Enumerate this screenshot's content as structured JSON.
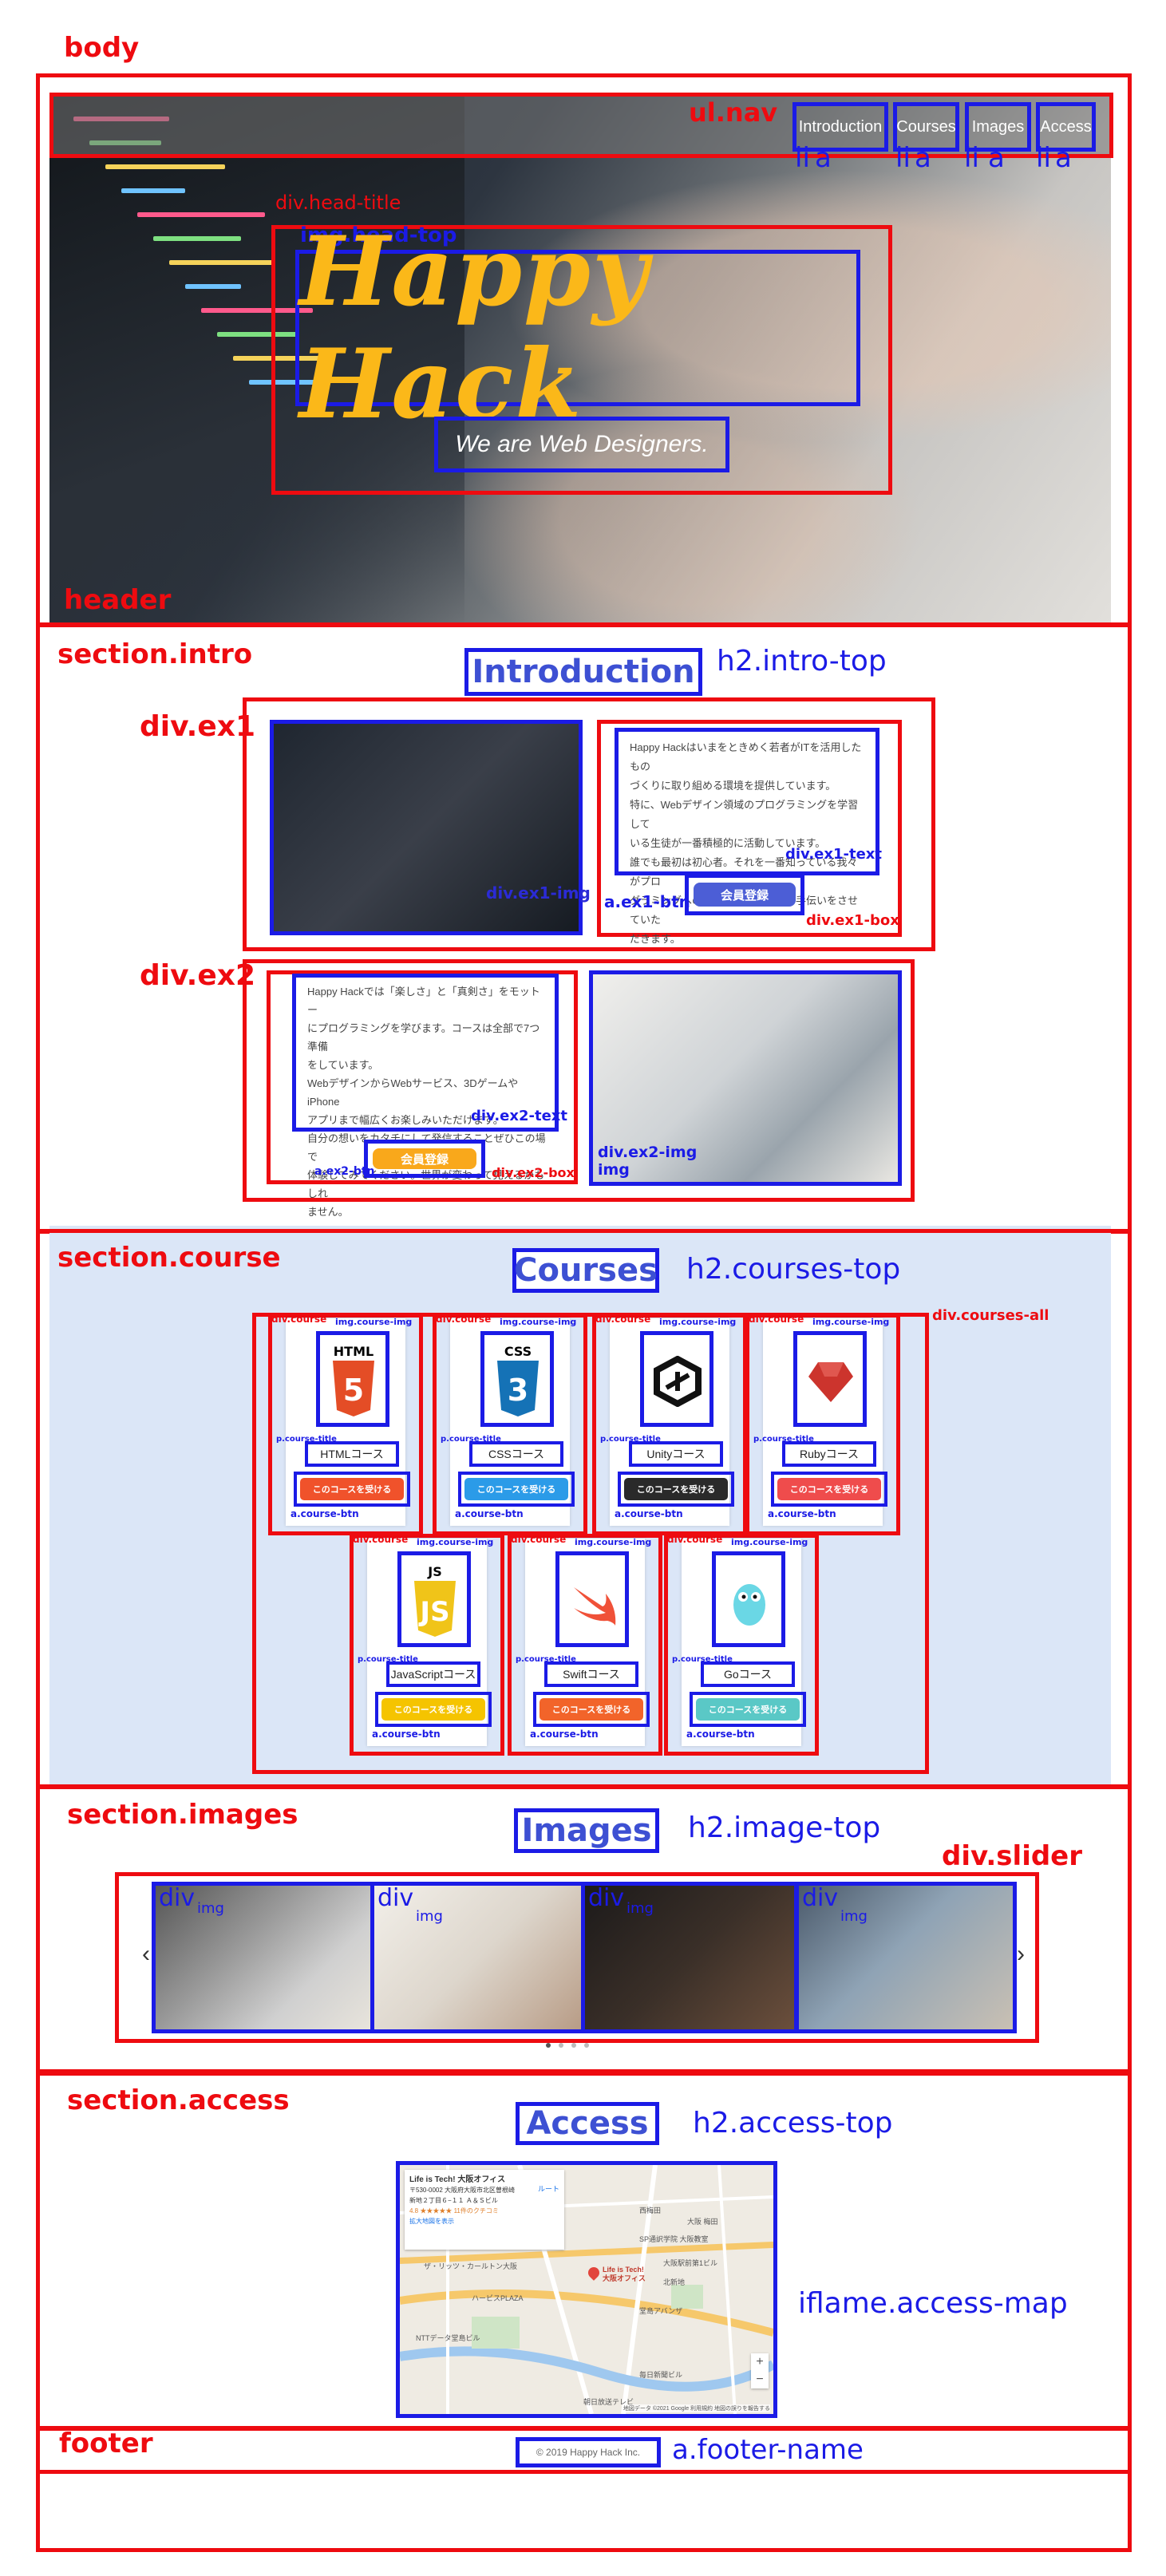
{
  "labels": {
    "body": "body",
    "header": "header",
    "ul_nav": "ul.nav",
    "head_title": "div.head-title",
    "img_head_top": "img.head-top",
    "section_intro": "section.intro",
    "h2_intro_top": "h2.intro-top",
    "div_ex1": "div.ex1",
    "div_ex1_img": "div.ex1-img",
    "div_ex1_text": "div.ex1-text",
    "a_ex1_btn": "a.ex1-btn",
    "div_ex1_box": "div.ex1-box",
    "div_ex2": "div.ex2",
    "div_ex2_text": "div.ex2-text",
    "a_ex2_btn": "a.ex2-btn",
    "div_ex2_box": "div.ex2-box",
    "div_ex2_img": "div.ex2-img",
    "img": "img",
    "section_course": "section.course",
    "h2_courses_top": "h2.courses-top",
    "div_courses_all": "div.courses-all",
    "div_course": "div.course",
    "img_course_img": "img.course-img",
    "p_course_title": "p.course-title",
    "a_course_btn": "a.course-btn",
    "section_images": "section.images",
    "h2_image_top": "h2.image-top",
    "div_slider": "div.slider",
    "div": "div",
    "section_access": "section.access",
    "h2_access_top": "h2.access-top",
    "iflame_access_map": "iflame.access-map",
    "footer": "footer",
    "a_footer_name": "a.footer-name",
    "li": "li",
    "a": "a"
  },
  "nav": {
    "items": [
      "Introduction",
      "Courses",
      "Images",
      "Access"
    ]
  },
  "header": {
    "title": "Happy Hack",
    "subtitle": "We are Web Designers."
  },
  "intro": {
    "heading": "Introduction",
    "ex1_text": [
      "Happy Hackはいまをときめく若者がITを活用したもの",
      "づくりに取り組める環境を提供しています。",
      "特に、Webデザイン領域のプログラミングを学習して",
      "いる生徒が一番積極的に活動しています。",
      "誰でも最初は初心者。それを一番知っている我々がプロ",
      "グラミングへの第一歩を踏み出すお手伝いをさせていた",
      "だきます。"
    ],
    "ex1_btn": "会員登録",
    "ex2_text": [
      "Happy Hackでは「楽しさ」と「真剣さ」をモットー",
      "にプログラミングを学びます。コースは全部で7つ準備",
      "をしています。",
      "WebデザインからWebサービス、3DゲームやiPhone",
      "アプリまで幅広くお楽しみいただけます。",
      "自分の想いをカタチにして発信することぜひこの場で",
      "体験してみてください。世界が変わって見えるかもしれ",
      "ません。"
    ],
    "ex2_btn": "会員登録"
  },
  "courses": {
    "heading": "Courses",
    "btn_label": "このコースを受ける",
    "items": [
      {
        "title": "HTMLコース",
        "icon": "HTML",
        "btn_color": "#f0522b"
      },
      {
        "title": "CSSコース",
        "icon": "CSS",
        "btn_color": "#2b9be8"
      },
      {
        "title": "Unityコース",
        "icon": "unity-icon",
        "btn_color": "#2a2a2a"
      },
      {
        "title": "Rubyコース",
        "icon": "ruby-icon",
        "btn_color": "#ef4c4c"
      },
      {
        "title": "JavaScriptコース",
        "icon": "JS",
        "btn_color": "#f5c400"
      },
      {
        "title": "Swiftコース",
        "icon": "swift-icon",
        "btn_color": "#f2642a"
      },
      {
        "title": "Goコース",
        "icon": "gopher-icon",
        "btn_color": "#5ac8c6"
      }
    ]
  },
  "images": {
    "heading": "Images",
    "prev": "‹",
    "next": "›"
  },
  "access": {
    "heading": "Access",
    "map_card_title": "Life is Tech! 大阪オフィス",
    "map_card_lines": [
      "〒530-0002 大阪府大阪市北区曽根崎",
      "新地２丁目６−１１ Ａ＆Ｓビル",
      "4.8 ★★★★★ 11件のクチコミ",
      "拡大地図を表示"
    ],
    "map_route": "ルート",
    "map_marker_label": "Life is Tech!\n大阪オフィス",
    "map_place_labels": [
      "西梅田",
      "SP通訳学院 大阪教室",
      "ザ・リッツ・カールトン大阪",
      "大阪駅前第1ビル",
      "大阪 梅田",
      "北新地",
      "堂島アバンザ",
      "毎日新聞ビル",
      "NTTデータ堂島ビル",
      "ハービスPLAZA",
      "朝日放送テレビ"
    ],
    "map_footer": "地図データ ©2021 Google   利用規約   地図の誤りを報告する",
    "map_zoom": [
      "+",
      "−"
    ]
  },
  "footer": {
    "name": "© 2019 Happy Hack Inc."
  },
  "colors": {
    "red": "#ee0b10",
    "blue": "#1b1be6",
    "heading": "#3d50d3",
    "accent": "#fbb819",
    "button": "#4c5ed6"
  }
}
